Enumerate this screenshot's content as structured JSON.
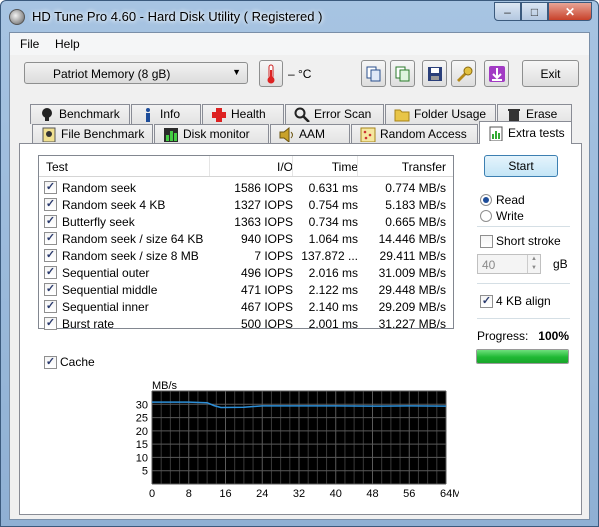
{
  "window": {
    "title": "HD Tune Pro 4.60 - Hard Disk Utility ( Registered )",
    "minimize": "–",
    "maximize": "□",
    "close": "✕"
  },
  "menu": {
    "file": "File",
    "help": "Help"
  },
  "toolbar": {
    "drive": "Patriot Memory  (8 gB)",
    "temperature": "– °C",
    "exit": "Exit"
  },
  "tabs_top": [
    "Benchmark",
    "Info",
    "Health",
    "Error Scan",
    "Folder Usage",
    "Erase"
  ],
  "tabs_bottom": [
    "File Benchmark",
    "Disk monitor",
    "AAM",
    "Random Access",
    "Extra tests"
  ],
  "table": {
    "headers": {
      "test": "Test",
      "io": "I/O",
      "time": "Time",
      "transfer": "Transfer"
    },
    "rows": [
      {
        "checked": true,
        "name": "Random seek",
        "io": "1586 IOPS",
        "time": "0.631 ms",
        "transfer": "0.774 MB/s"
      },
      {
        "checked": true,
        "name": "Random seek 4 KB",
        "io": "1327 IOPS",
        "time": "0.754 ms",
        "transfer": "5.183 MB/s"
      },
      {
        "checked": true,
        "name": "Butterfly seek",
        "io": "1363 IOPS",
        "time": "0.734 ms",
        "transfer": "0.665 MB/s"
      },
      {
        "checked": true,
        "name": "Random seek / size 64 KB",
        "io": "940 IOPS",
        "time": "1.064 ms",
        "transfer": "14.446 MB/s"
      },
      {
        "checked": true,
        "name": "Random seek / size 8 MB",
        "io": "7 IOPS",
        "time": "137.872 ...",
        "transfer": "29.411 MB/s"
      },
      {
        "checked": true,
        "name": "Sequential outer",
        "io": "496 IOPS",
        "time": "2.016 ms",
        "transfer": "31.009 MB/s"
      },
      {
        "checked": true,
        "name": "Sequential middle",
        "io": "471 IOPS",
        "time": "2.122 ms",
        "transfer": "29.448 MB/s"
      },
      {
        "checked": true,
        "name": "Sequential inner",
        "io": "467 IOPS",
        "time": "2.140 ms",
        "transfer": "29.209 MB/s"
      },
      {
        "checked": true,
        "name": "Burst rate",
        "io": "500 IOPS",
        "time": "2.001 ms",
        "transfer": "31.227 MB/s"
      }
    ]
  },
  "controls": {
    "start": "Start",
    "read": "Read",
    "write": "Write",
    "mode": "read",
    "short_stroke": "Short stroke",
    "short_stroke_checked": false,
    "short_stroke_value": "40",
    "short_stroke_unit": "gB",
    "align": "4 KB align",
    "align_checked": true,
    "progress_label": "Progress:",
    "progress_value": "100%",
    "progress_fraction": 1.0,
    "cache": "Cache",
    "cache_checked": true
  },
  "chart_data": {
    "type": "line",
    "ylabel": "MB/s",
    "x_unit": "MB",
    "x_ticks": [
      "0",
      "8",
      "16",
      "24",
      "32",
      "40",
      "48",
      "56",
      "64MB"
    ],
    "y_ticks": [
      "30",
      "25",
      "20",
      "15",
      "10",
      "5"
    ],
    "xlim": [
      0,
      64
    ],
    "ylim": [
      0,
      35
    ],
    "grid": true,
    "colors": {
      "background": "#000000",
      "grid": "#5a5a5a",
      "line": "#2d8fd8"
    },
    "series": [
      {
        "x": [
          0,
          8,
          12,
          13.5,
          15,
          20,
          24,
          30,
          40,
          48,
          56,
          64
        ],
        "y": [
          30.8,
          30.8,
          30.6,
          29.5,
          28.8,
          28.9,
          29.4,
          29.4,
          29.4,
          29.3,
          29.4,
          29.3
        ]
      }
    ]
  }
}
